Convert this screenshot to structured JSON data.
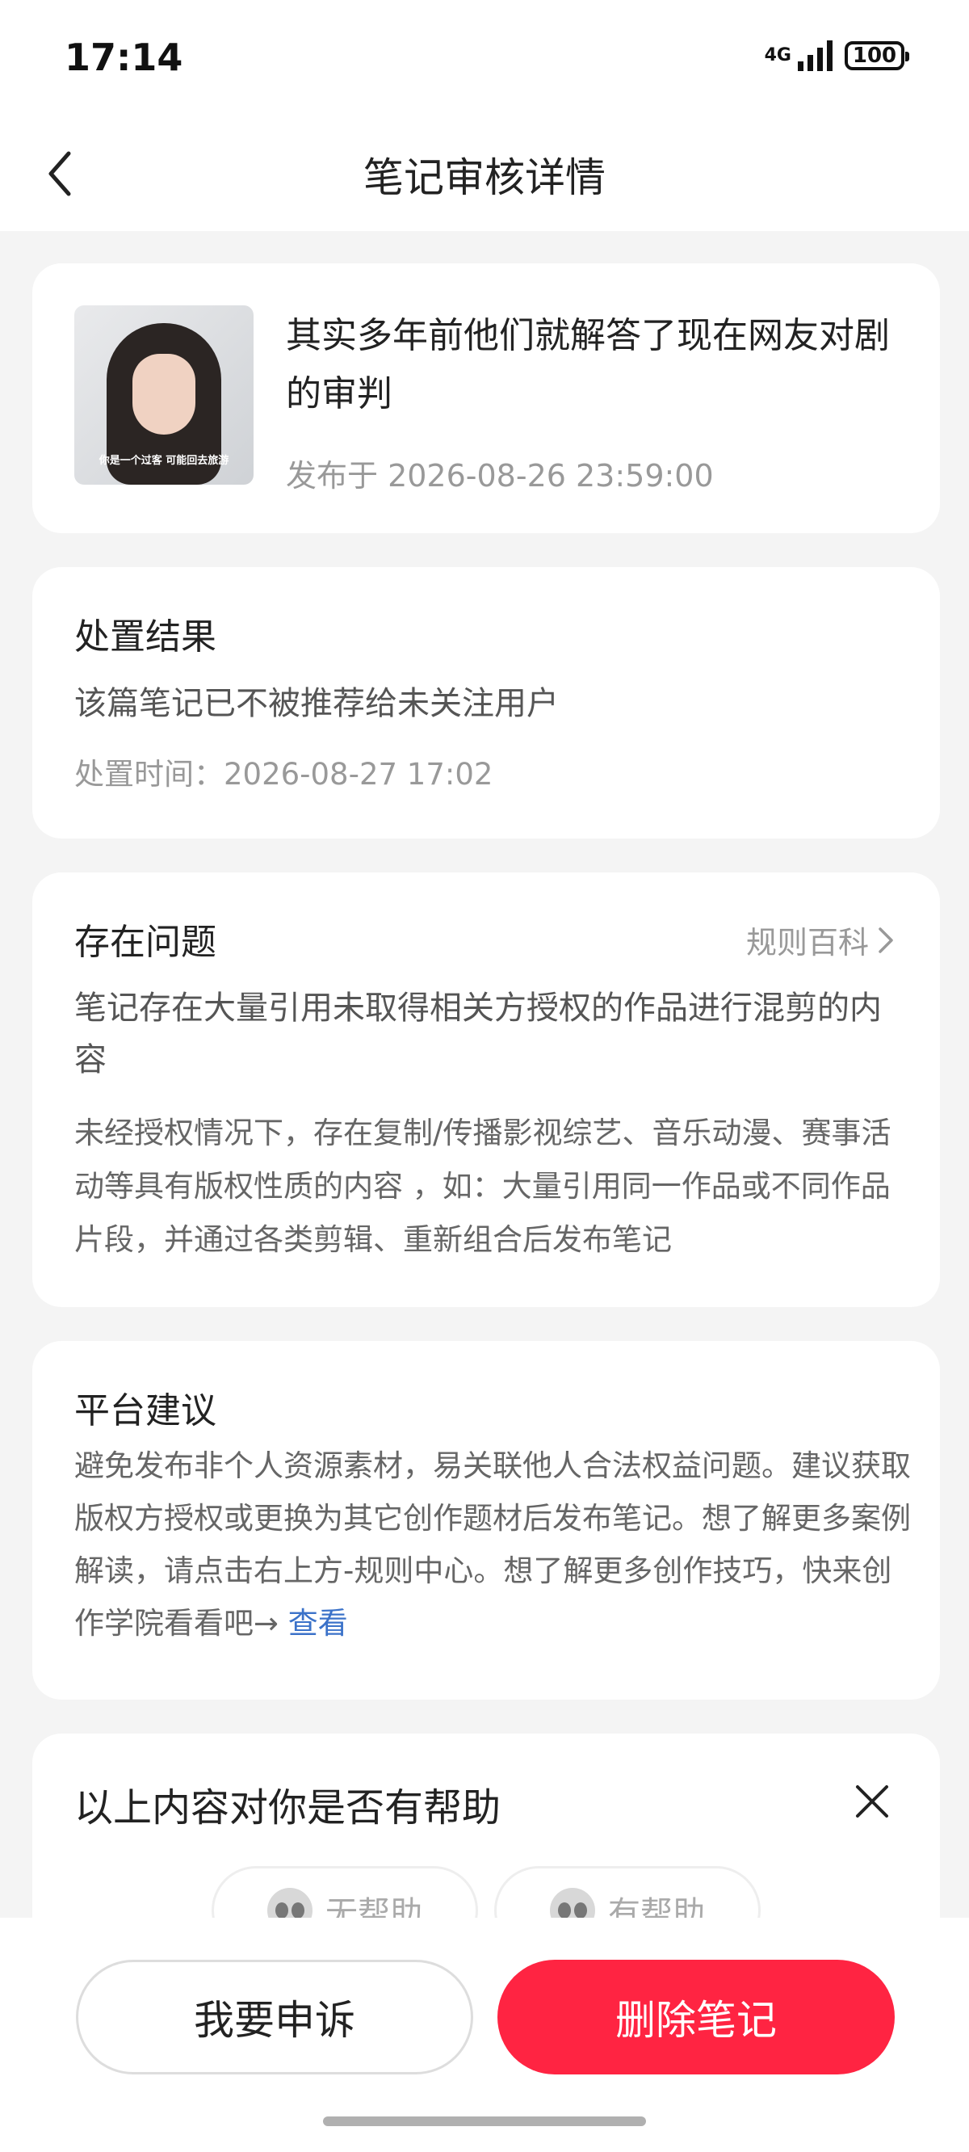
{
  "status_bar": {
    "time": "17:14",
    "network": "4G",
    "battery": "100"
  },
  "header": {
    "title": "笔记审核详情"
  },
  "note": {
    "title": "其实多年前他们就解答了现在网友对剧的审判",
    "published": "发布于 2026-08-26 23:59:00",
    "thumbnail_caption": "你是一个过客 可能回去旅游"
  },
  "result": {
    "heading": "处置结果",
    "text": "该篇笔记已不被推荐给未关注用户",
    "time": "处置时间：2026-08-27 17:02"
  },
  "issue": {
    "heading": "存在问题",
    "rules_link": "规则百科",
    "title": "笔记存在大量引用未取得相关方授权的作品进行混剪的内容",
    "description": "未经授权情况下，存在复制/传播影视综艺、音乐动漫、赛事活动等具有版权性质的内容 ，如：大量引用同一作品或不同作品片段，并通过各类剪辑、重新组合后发布笔记"
  },
  "suggestion": {
    "heading": "平台建议",
    "body": "避免发布非个人资源素材，易关联他人合法权益问题。建议获取版权方授权或更换为其它创作题材后发布笔记。想了解更多案例解读，请点击右上方-规则中心。想了解更多创作技巧，快来创作学院看看吧→ ",
    "link": "查看"
  },
  "feedback": {
    "question": "以上内容对你是否有帮助",
    "no_help": "无帮助",
    "helpful": "有帮助"
  },
  "actions": {
    "appeal": "我要申诉",
    "delete": "删除笔记"
  },
  "colors": {
    "accent": "#ff2442",
    "link": "#3b72c9",
    "background": "#f4f4f4"
  }
}
